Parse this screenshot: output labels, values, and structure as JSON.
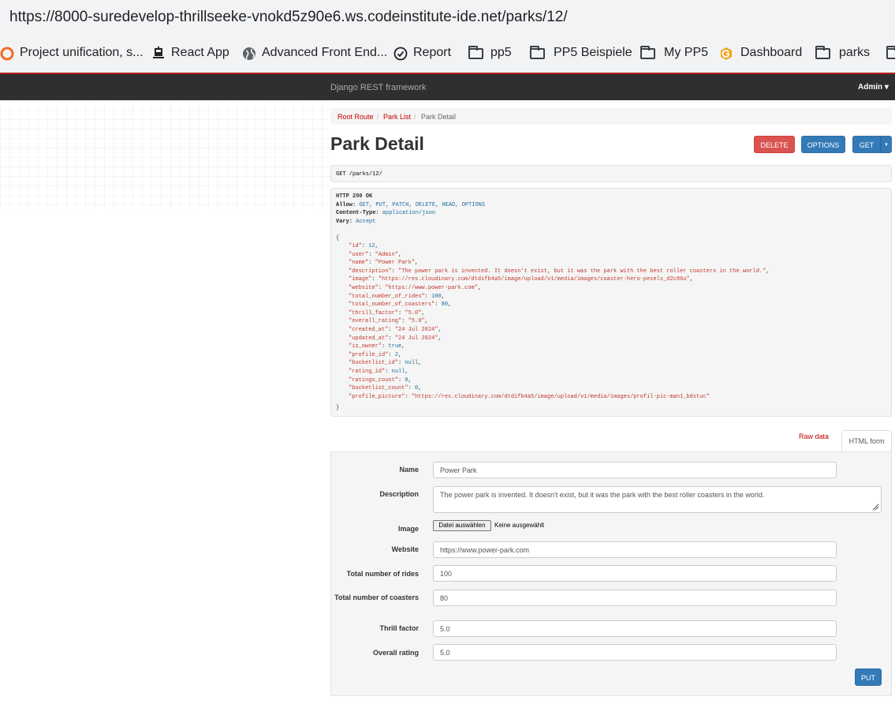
{
  "browser": {
    "url": "https://8000-suredevelop-thrillseeke-vnokd5z90e6.ws.codeinstitute-ide.net/parks/12/",
    "bookmarks": [
      {
        "label": "Project unification, s...",
        "icon": "ring-icon"
      },
      {
        "label": "React App",
        "icon": "train-icon"
      },
      {
        "label": "Advanced Front End...",
        "icon": "globe-icon"
      },
      {
        "label": "Report",
        "icon": "check-circle-icon"
      },
      {
        "label": "pp5",
        "icon": "folder-icon"
      },
      {
        "label": "PP5 Beispiele",
        "icon": "folder-icon"
      },
      {
        "label": "My PP5",
        "icon": "folder-icon"
      },
      {
        "label": "Dashboard",
        "icon": "g-logo-icon"
      },
      {
        "label": "parks",
        "icon": "folder-icon"
      }
    ]
  },
  "navbar": {
    "brand": "Django REST framework",
    "user": "Admin ▾"
  },
  "breadcrumb": {
    "root": "Root Route",
    "list": "Park List",
    "current": "Park Detail",
    "sep": "/"
  },
  "page": {
    "title": "Park Detail"
  },
  "buttons": {
    "delete": "DELETE",
    "options": "OPTIONS",
    "get": "GET",
    "caret": "▾",
    "put": "PUT"
  },
  "request": {
    "text": "GET /parks/12/"
  },
  "response": {
    "status": "HTTP 200 OK",
    "headers": [
      {
        "key": "Allow:",
        "value": "GET, PUT, PATCH, DELETE, HEAD, OPTIONS"
      },
      {
        "key": "Content-Type:",
        "value": "application/json"
      },
      {
        "key": "Vary:",
        "value": "Accept"
      }
    ],
    "open": "{",
    "close": "}",
    "fields": [
      {
        "key": "\"id\"",
        "value": "12",
        "str": false
      },
      {
        "key": "\"user\"",
        "value": "\"Admin\"",
        "str": true
      },
      {
        "key": "\"name\"",
        "value": "\"Power Park\"",
        "str": true
      },
      {
        "key": "\"description\"",
        "value": "\"The power park is invented. It doesn't exist, but it was the park with the best roller coasters in the world.\"",
        "str": true
      },
      {
        "key": "\"image\"",
        "value": "\"https://res.cloudinary.com/dtdifb4a5/image/upload/v1/media/images/coaster-hero-pexels_d2c86u\"",
        "str": true
      },
      {
        "key": "\"website\"",
        "value": "\"https://www.power-park.com\"",
        "str": true
      },
      {
        "key": "\"total_number_of_rides\"",
        "value": "100",
        "str": false
      },
      {
        "key": "\"total_number_of_coasters\"",
        "value": "80",
        "str": false
      },
      {
        "key": "\"thrill_factor\"",
        "value": "\"5.0\"",
        "str": true
      },
      {
        "key": "\"overall_rating\"",
        "value": "\"5.0\"",
        "str": true
      },
      {
        "key": "\"created_at\"",
        "value": "\"24 Jul 2024\"",
        "str": true
      },
      {
        "key": "\"updated_at\"",
        "value": "\"24 Jul 2024\"",
        "str": true
      },
      {
        "key": "\"is_owner\"",
        "value": "true",
        "str": false
      },
      {
        "key": "\"profile_id\"",
        "value": "2",
        "str": false
      },
      {
        "key": "\"bucketlist_id\"",
        "value": "null",
        "str": false
      },
      {
        "key": "\"rating_id\"",
        "value": "null",
        "str": false
      },
      {
        "key": "\"ratings_count\"",
        "value": "0",
        "str": false
      },
      {
        "key": "\"bucketlist_count\"",
        "value": "0",
        "str": false
      },
      {
        "key": "\"profile_picture\"",
        "value": "\"https://res.cloudinary.com/dtdifb4a5/image/upload/v1/media/images/profil-pic-man1_bdstuc\"",
        "str": true
      }
    ]
  },
  "tabs": {
    "raw": "Raw data",
    "html": "HTML form"
  },
  "form": {
    "name": {
      "label": "Name",
      "value": "Power Park"
    },
    "description": {
      "label": "Description",
      "value": "The power park is invented. It doesn't exist, but it was the park with the best roller coasters in the world."
    },
    "image": {
      "label": "Image",
      "button": "Datei auswählen",
      "none": "Keine ausgewählt"
    },
    "website": {
      "label": "Website",
      "value": "https://www.power-park.com"
    },
    "rides": {
      "label": "Total number of rides",
      "value": "100"
    },
    "coasters": {
      "label": "Total number of coasters",
      "value": "80"
    },
    "thrill": {
      "label": "Thrill factor",
      "value": "5.0"
    },
    "rating": {
      "label": "Overall rating",
      "value": "5.0"
    }
  },
  "colors": {
    "accent": "#c20000",
    "primary": "#337ab7",
    "danger": "#d9534f",
    "navbar": "#2f2f2f"
  }
}
